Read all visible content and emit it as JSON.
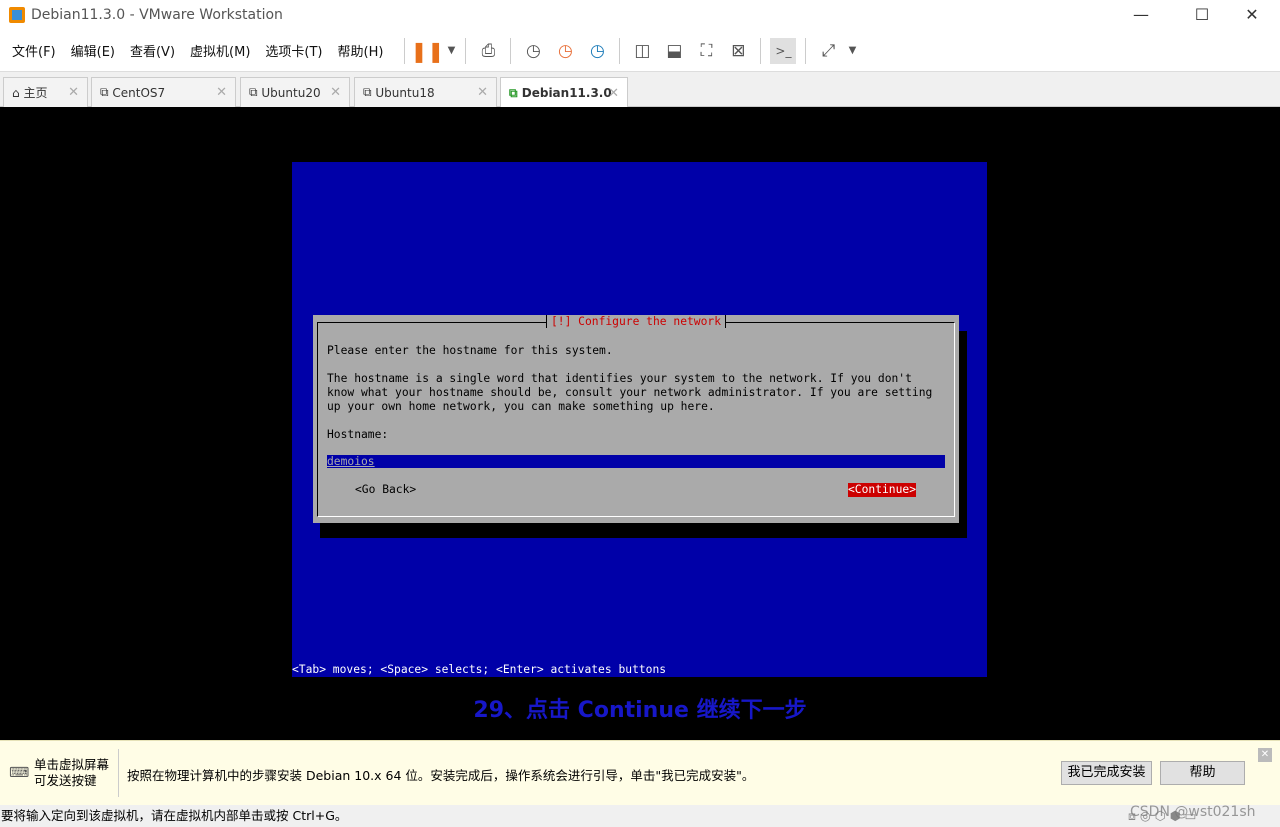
{
  "window": {
    "title": "Debian11.3.0 - VMware Workstation",
    "minimize": "—",
    "maximize": "☐",
    "close": "✕"
  },
  "menu": [
    "文件(F)",
    "编辑(E)",
    "查看(V)",
    "虚拟机(M)",
    "选项卡(T)",
    "帮助(H)"
  ],
  "tabs": [
    {
      "label": "主页"
    },
    {
      "label": "CentOS7"
    },
    {
      "label": "Ubuntu20"
    },
    {
      "label": "Ubuntu18"
    },
    {
      "label": "Debian11.3.0"
    }
  ],
  "installer": {
    "dialog_title": "[!] Configure the network",
    "prompt": "Please enter the hostname for this system.",
    "description": [
      "The hostname is a single word that identifies your system to the network. If you don't",
      "know what your hostname should be, consult your network administrator. If you are setting",
      "up your own home network, you can make something up here."
    ],
    "field_label": "Hostname:",
    "hostname_value": "demoios",
    "go_back": "<Go Back>",
    "continue": "<Continue>",
    "hint": "<Tab> moves; <Space> selects; <Enter> activates buttons"
  },
  "caption": "29、点击 Continue 继续下一步",
  "infobar": {
    "left_line1": "单击虚拟屏幕",
    "left_line2": "可发送按键",
    "message": "按照在物理计算机中的步骤安装 Debian 10.x 64 位。安装完成后，操作系统会进行引导，单击\"我已完成安装\"。",
    "done_button": "我已完成安装",
    "help_button": "帮助",
    "close": "✕"
  },
  "statusbar": {
    "text": "要将输入定向到该虚拟机，请在虚拟机内部单击或按 Ctrl+G。",
    "watermark": "CSDN @wst021sh"
  }
}
